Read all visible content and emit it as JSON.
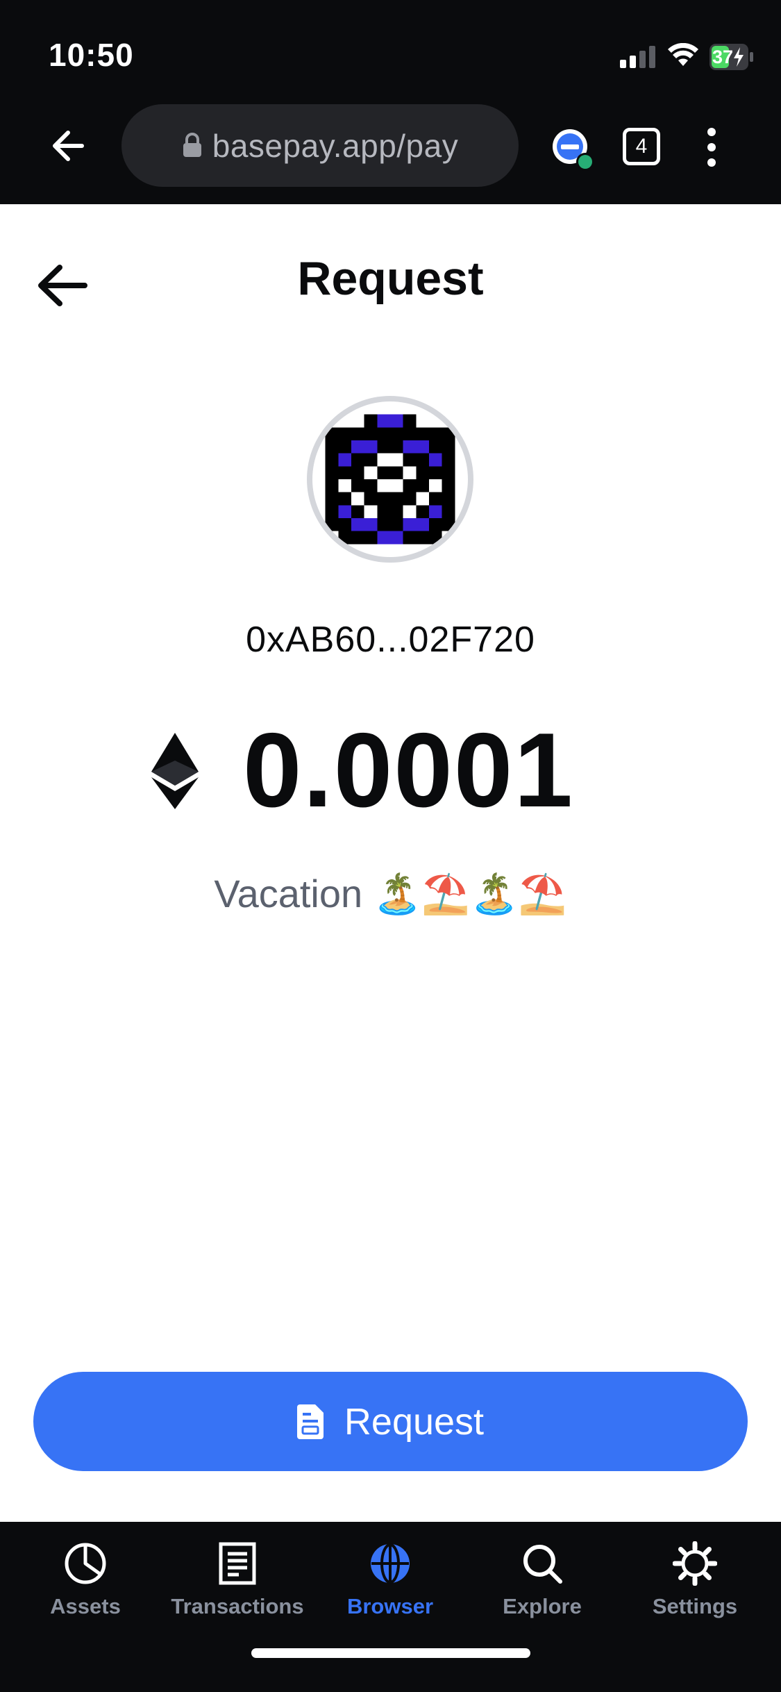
{
  "status_bar": {
    "time": "10:50",
    "battery": "37"
  },
  "browser": {
    "url": "basepay.app/pay",
    "tab_count": "4"
  },
  "page": {
    "title": "Request",
    "address": "0xAB60...02F720",
    "amount": "0.0001",
    "asset_icon": "ethereum-icon",
    "memo": "Vacation 🏝️⛱️🏝️⛱️",
    "request_button_label": "Request"
  },
  "nav": {
    "items": [
      {
        "label": "Assets",
        "icon": "pie-chart-icon"
      },
      {
        "label": "Transactions",
        "icon": "document-icon"
      },
      {
        "label": "Browser",
        "icon": "globe-icon",
        "active": true
      },
      {
        "label": "Explore",
        "icon": "search-icon"
      },
      {
        "label": "Settings",
        "icon": "gear-icon"
      }
    ]
  },
  "colors": {
    "accent": "#3773f5",
    "chrome_bg": "#0a0b0d",
    "battery_green": "#4cd964",
    "muted_text": "#5b616e",
    "nav_inactive": "#8a919e"
  }
}
